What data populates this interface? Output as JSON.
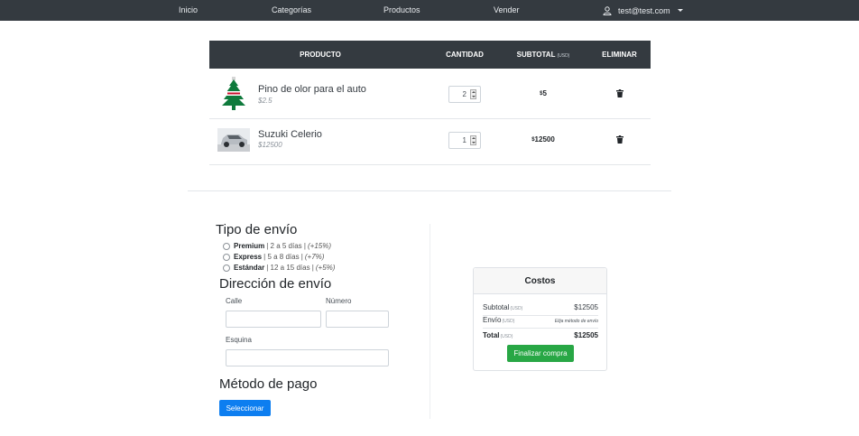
{
  "nav": {
    "items": [
      "Inicio",
      "Categorías",
      "Productos",
      "Vender"
    ],
    "user_email": "test@test.com"
  },
  "cart": {
    "headers": {
      "product": "PRODUCTO",
      "quantity": "CANTIDAD",
      "subtotal": "SUBTOTAL",
      "subtotal_currency": "(USD)",
      "remove": "ELIMINAR"
    },
    "items": [
      {
        "name": "Pino de olor para el auto",
        "price": "$2.5",
        "quantity": "2",
        "subtotal_currency": "$",
        "subtotal": "5",
        "image": "pine-air-freshener"
      },
      {
        "name": "Suzuki Celerio",
        "price": "$12500",
        "quantity": "1",
        "subtotal_currency": "$",
        "subtotal": "12500",
        "image": "silver-car"
      }
    ]
  },
  "shipping": {
    "title": "Tipo de envío",
    "options": [
      {
        "name": "Premium",
        "days": "| 2 a 5 días |",
        "pct": "(+15%)"
      },
      {
        "name": "Express",
        "days": "| 5 a 8 días |",
        "pct": "(+7%)"
      },
      {
        "name": "Estándar",
        "days": "| 12 a 15 días |",
        "pct": "(+5%)"
      }
    ]
  },
  "address": {
    "title": "Dirección de envío",
    "street_label": "Calle",
    "number_label": "Número",
    "corner_label": "Esquina",
    "street_value": "",
    "number_value": "",
    "corner_value": ""
  },
  "payment": {
    "title": "Método de pago",
    "select_button": "Seleccionar"
  },
  "costs": {
    "title": "Costos",
    "subtotal_label": "Subtotal",
    "subtotal_unit": "(USD)",
    "subtotal_value": "$12505",
    "shipping_label": "Envío",
    "shipping_unit": "(USD)",
    "shipping_value": "Elija método de envío",
    "total_label": "Total",
    "total_unit": "(USD)",
    "total_value": "$12505",
    "finish_button": "Finalizar compra"
  },
  "colors": {
    "navbar": "#343a40",
    "primary": "#0d7ef0",
    "success": "#28a745"
  }
}
